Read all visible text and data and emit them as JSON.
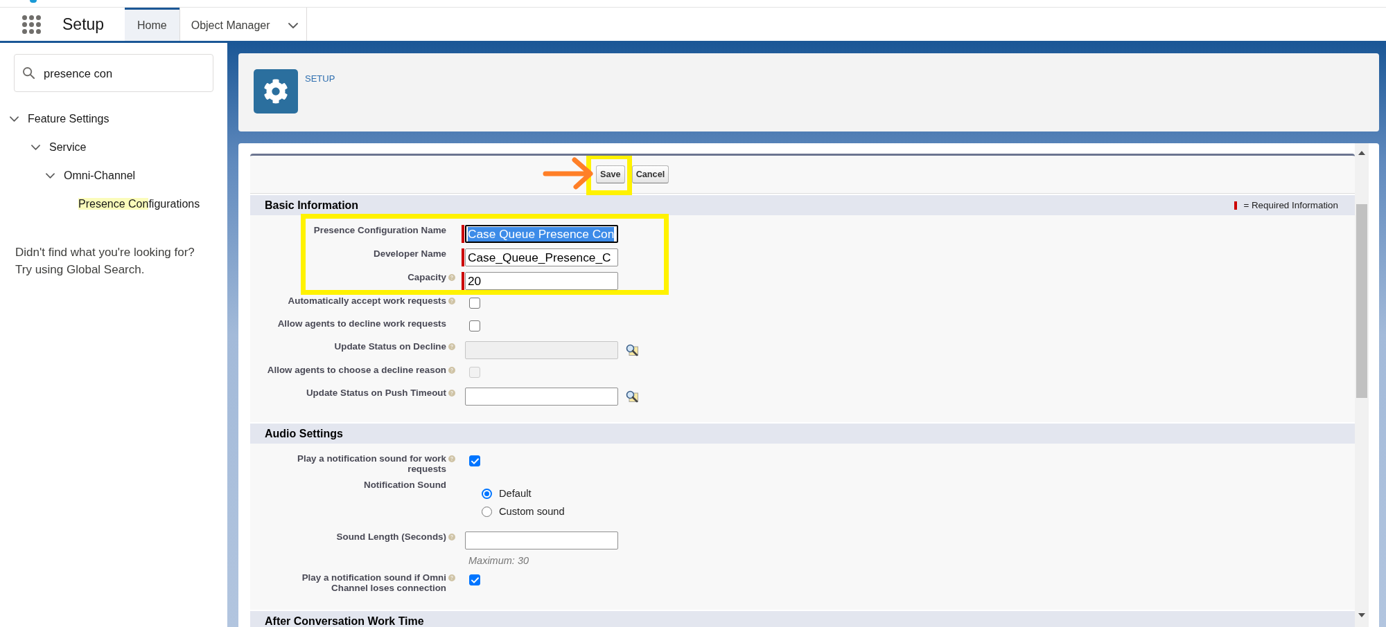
{
  "top_bar": {
    "app_title": "Setup",
    "tabs": [
      {
        "label": "Home",
        "selected": true,
        "dropdown": false
      },
      {
        "label": "Object Manager",
        "selected": false,
        "dropdown": true
      }
    ]
  },
  "sidebar": {
    "search": {
      "value": "presence con"
    },
    "tree": [
      {
        "label": "Feature Settings",
        "expanded": true,
        "children": [
          {
            "label": "Service",
            "expanded": true,
            "children": [
              {
                "label": "Omni-Channel",
                "expanded": true,
                "children": [
                  {
                    "segments": [
                      {
                        "text": "Presence Con",
                        "highlighted": true
                      },
                      {
                        "text": "figurations",
                        "highlighted": false
                      }
                    ]
                  }
                ]
              }
            ]
          }
        ]
      }
    ],
    "help_text": "Didn't find what you're looking for? Try using Global Search."
  },
  "page_header": {
    "title": "SETUP"
  },
  "form": {
    "buttons": [
      {
        "label": "Save",
        "marked": true
      },
      {
        "label": "Cancel",
        "marked": false
      }
    ],
    "sections": [
      {
        "title": "Basic Information",
        "legend": "= Required Information",
        "rows": [
          {
            "kind": "text",
            "label": "Presence Configuration Name",
            "help": false,
            "required": true,
            "value": "Case Queue Presence Con",
            "focused": true,
            "disabled": false,
            "lookup": false,
            "marked": true
          },
          {
            "kind": "text",
            "label": "Developer Name",
            "help": false,
            "required": true,
            "value": "Case_Queue_Presence_C",
            "focused": false,
            "disabled": false,
            "lookup": false,
            "marked": true
          },
          {
            "kind": "text",
            "label": "Capacity",
            "help": true,
            "required": true,
            "value": "20",
            "focused": false,
            "disabled": false,
            "lookup": false,
            "marked": true
          },
          {
            "kind": "checkbox",
            "label": "Automatically accept work requests",
            "help": true,
            "checked": false,
            "disabled": false,
            "marked": false
          },
          {
            "kind": "checkbox",
            "label": "Allow agents to decline work requests",
            "help": false,
            "checked": false,
            "disabled": false,
            "marked": false
          },
          {
            "kind": "text",
            "label": "Update Status on Decline",
            "help": true,
            "required": false,
            "focused": false,
            "disabled": true,
            "lookup": true,
            "marked": false
          },
          {
            "kind": "checkbox",
            "label": "Allow agents to choose a decline reason",
            "help": true,
            "checked": false,
            "disabled": true,
            "marked": false
          },
          {
            "kind": "text",
            "label": "Update Status on Push Timeout",
            "help": true,
            "required": false,
            "focused": false,
            "disabled": false,
            "lookup": true,
            "marked": false
          }
        ]
      },
      {
        "title": "Audio Settings",
        "rows": [
          {
            "kind": "checkbox",
            "label": "Play a notification sound for work requests",
            "help": true,
            "checked": true,
            "disabled": false,
            "marked": false
          },
          {
            "kind": "radio",
            "label": "Notification Sound",
            "help": false,
            "options": [
              {
                "label": "Default",
                "selected": true
              },
              {
                "label": "Custom sound",
                "selected": false
              }
            ],
            "marked": false
          },
          {
            "kind": "text",
            "label": "Sound Length (Seconds)",
            "help": true,
            "required": false,
            "focused": false,
            "disabled": false,
            "lookup": false,
            "note": "Maximum: 30",
            "marked": false
          },
          {
            "kind": "checkbox",
            "label": "Play a notification sound if Omni Channel loses connection",
            "help": true,
            "checked": true,
            "disabled": false,
            "marked": false
          }
        ]
      },
      {
        "title": "After Conversation Work Time"
      }
    ]
  }
}
